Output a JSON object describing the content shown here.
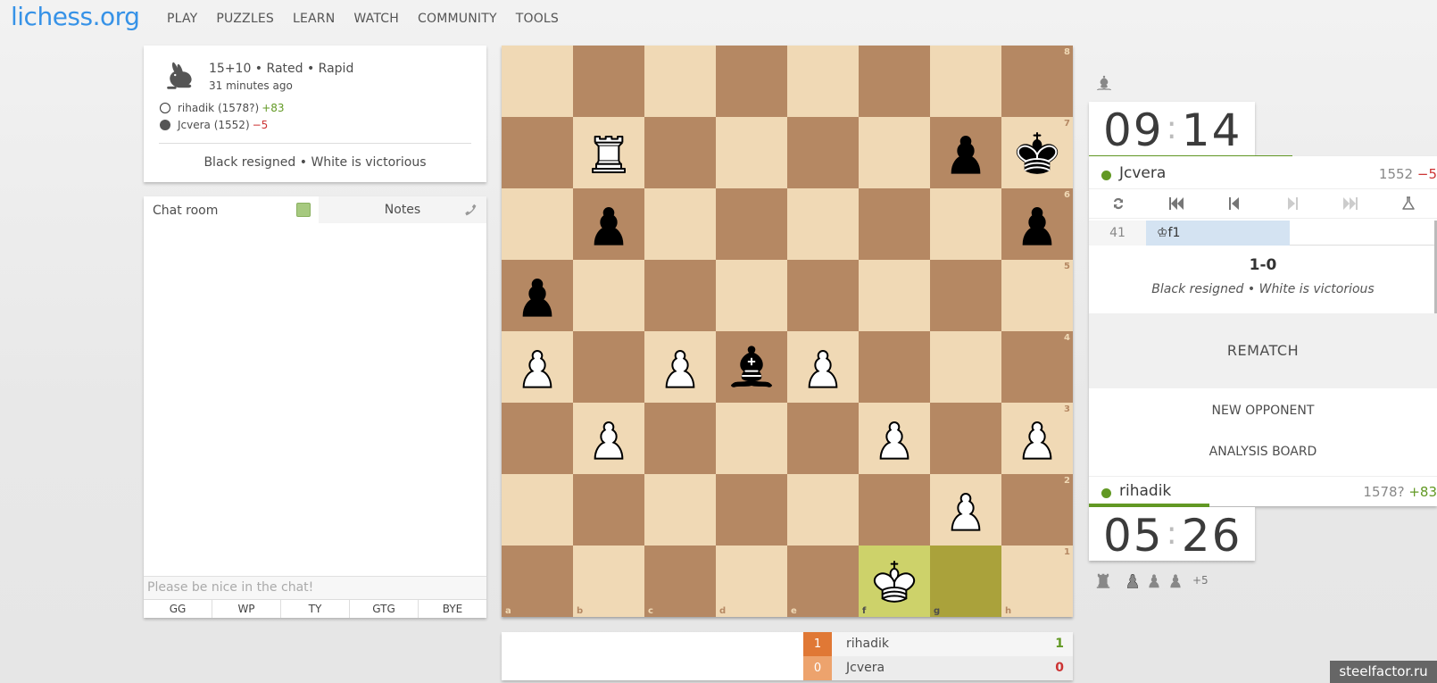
{
  "header": {
    "logo": "lichess.org",
    "nav": [
      "PLAY",
      "PUZZLES",
      "LEARN",
      "WATCH",
      "COMMUNITY",
      "TOOLS"
    ]
  },
  "game_info": {
    "icon": "rabbit-icon",
    "setup": "15+10 • Rated • Rapid",
    "time_ago": "31 minutes ago",
    "white_player": {
      "name": "rihadik (1578?)",
      "diff": "+83"
    },
    "black_player": {
      "name": "Jcvera (1552)",
      "diff": "−5"
    },
    "status": "Black resigned • White is victorious"
  },
  "chat": {
    "tab_chat": "Chat room",
    "tab_notes": "Notes",
    "placeholder": "Please be nice in the chat!",
    "presets": [
      "GG",
      "WP",
      "TY",
      "GTG",
      "BYE"
    ]
  },
  "board": {
    "files": [
      "a",
      "b",
      "c",
      "d",
      "e",
      "f",
      "g",
      "h"
    ],
    "ranks": [
      "8",
      "7",
      "6",
      "5",
      "4",
      "3",
      "2",
      "1"
    ],
    "squares": [
      [
        "",
        "",
        "",
        "",
        "",
        "",
        "",
        ""
      ],
      [
        "",
        "wR",
        "",
        "",
        "",
        "",
        "bP",
        "bK"
      ],
      [
        "",
        "bP",
        "",
        "",
        "",
        "",
        "",
        "bP"
      ],
      [
        "bP",
        "",
        "",
        "",
        "",
        "",
        "",
        ""
      ],
      [
        "wP",
        "",
        "wP",
        "bB",
        "wP",
        "",
        "",
        ""
      ],
      [
        "",
        "wP",
        "",
        "",
        "",
        "wP",
        "",
        "wP"
      ],
      [
        "",
        "",
        "",
        "",
        "",
        "",
        "wP",
        ""
      ],
      [
        "",
        "",
        "",
        "",
        "",
        "wK",
        "",
        ""
      ]
    ],
    "last_move": [
      "g1",
      "f1"
    ]
  },
  "crosstable": {
    "rows": [
      {
        "score_box": "1",
        "name": "rihadik",
        "score": "1"
      },
      {
        "score_box": "0",
        "name": "Jcvera",
        "score": "0"
      }
    ]
  },
  "top_player": {
    "name": "Jcvera",
    "rating": "1552",
    "diff": "−5",
    "clock_min": "09",
    "clock_sec": "14",
    "captured_icon": "bishop-icon",
    "clock_remaining": 0.66
  },
  "bottom_player": {
    "name": "rihadik",
    "rating": "1578?",
    "diff": "+83",
    "clock_min": "05",
    "clock_sec": "26",
    "captured_icons": [
      "rook-icon",
      "pawn-icon",
      "pawn-icon",
      "pawn-icon"
    ],
    "material_advantage": "+5",
    "clock_remaining": 0.36
  },
  "controls": [
    "flip-board-icon",
    "first-move-icon",
    "prev-move-icon",
    "next-move-icon",
    "last-move-icon",
    "analysis-icon"
  ],
  "moves": {
    "number": "41",
    "white": "♔f1"
  },
  "result": {
    "score": "1-0",
    "desc": "Black resigned • White is victorious"
  },
  "buttons": {
    "rematch": "REMATCH",
    "new_opponent": "NEW OPPONENT",
    "analysis_board": "ANALYSIS BOARD"
  },
  "watermark": "steelfactor.ru",
  "colors": {
    "light_square": "#f0d9b5",
    "dark_square": "#b58863",
    "accent": "#3692e7",
    "positive": "#629924",
    "negative": "#cc3333"
  }
}
